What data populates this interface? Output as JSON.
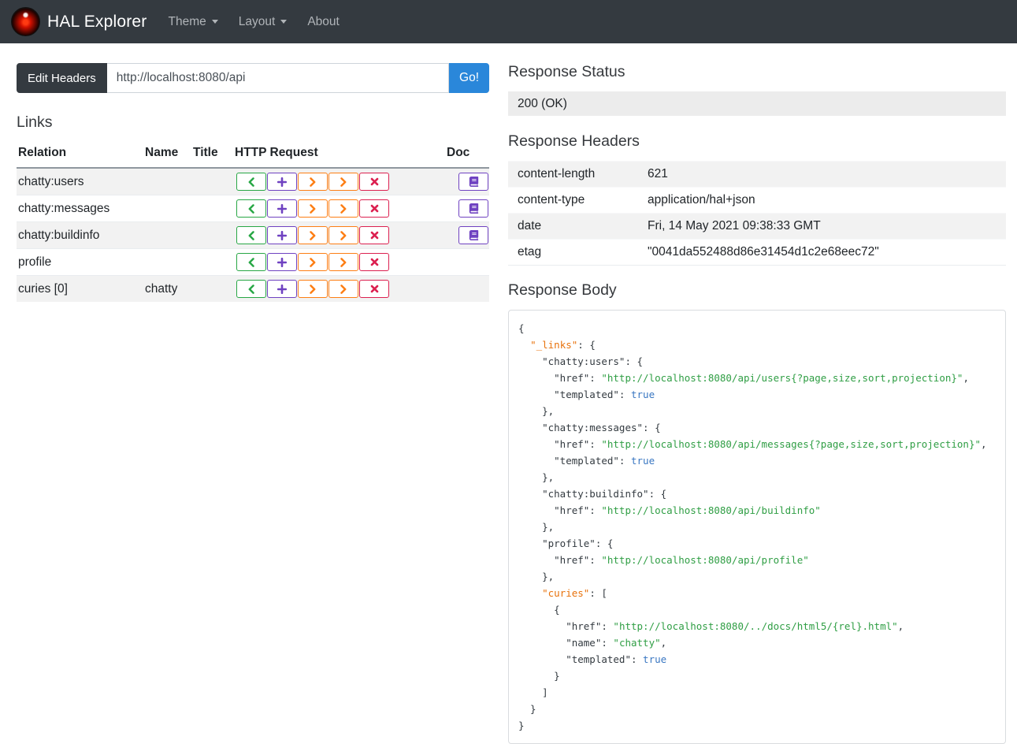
{
  "navbar": {
    "brand": "HAL Explorer",
    "logo": "hal-9000-eye-icon",
    "items": [
      {
        "label": "Theme",
        "has_caret": true
      },
      {
        "label": "Layout",
        "has_caret": true
      },
      {
        "label": "About",
        "has_caret": false
      }
    ]
  },
  "request_bar": {
    "edit_headers_label": "Edit Headers",
    "url_value": "http://localhost:8080/api",
    "go_label": "Go!"
  },
  "links_section": {
    "title": "Links",
    "columns": {
      "relation": "Relation",
      "name": "Name",
      "title": "Title",
      "http_request": "HTTP Request",
      "doc": "Doc"
    },
    "http_buttons": [
      {
        "method": "get",
        "icon": "chevron-left-icon",
        "color": "#28a745"
      },
      {
        "method": "post",
        "icon": "plus-icon",
        "color": "#6f42c1"
      },
      {
        "method": "put",
        "icon": "chevron-right-icon",
        "color": "#fd7e14"
      },
      {
        "method": "patch",
        "icon": "chevron-right-icon",
        "color": "#fd7e14"
      },
      {
        "method": "delete",
        "icon": "x-icon",
        "color": "#dc2050"
      }
    ],
    "doc_button": {
      "icon": "book-icon",
      "color": "#6f42c1"
    },
    "rows": [
      {
        "relation": "chatty:users",
        "name": "",
        "title": "",
        "doc": true
      },
      {
        "relation": "chatty:messages",
        "name": "",
        "title": "",
        "doc": true
      },
      {
        "relation": "chatty:buildinfo",
        "name": "",
        "title": "",
        "doc": true
      },
      {
        "relation": "profile",
        "name": "",
        "title": "",
        "doc": false
      },
      {
        "relation": "curies [0]",
        "name": "chatty",
        "title": "",
        "doc": false
      }
    ]
  },
  "response": {
    "status": {
      "title": "Response Status",
      "value": "200 (OK)"
    },
    "headers": {
      "title": "Response Headers",
      "rows": [
        {
          "name": "content-length",
          "value": "621"
        },
        {
          "name": "content-type",
          "value": "application/hal+json"
        },
        {
          "name": "date",
          "value": "Fri, 14 May 2021 09:38:33 GMT"
        },
        {
          "name": "etag",
          "value": "\"0041da552488d86e31454d1c2e68eec72\""
        }
      ]
    },
    "body": {
      "title": "Response Body",
      "syntax_colors": {
        "plain": "#333a40",
        "hal_key": "#e8720c",
        "string": "#2f9e44",
        "boolean": "#3a77c2"
      },
      "lines": [
        [
          [
            "p",
            "{"
          ]
        ],
        [
          [
            "p",
            "  "
          ],
          [
            "k",
            "\"_links\""
          ],
          [
            "p",
            ": {"
          ]
        ],
        [
          [
            "p",
            "    \"chatty:users\": {"
          ]
        ],
        [
          [
            "p",
            "      \"href\": "
          ],
          [
            "s",
            "\"http://localhost:8080/api/users{?page,size,sort,projection}\""
          ],
          [
            "p",
            ","
          ]
        ],
        [
          [
            "p",
            "      \"templated\": "
          ],
          [
            "b",
            "true"
          ]
        ],
        [
          [
            "p",
            "    },"
          ]
        ],
        [
          [
            "p",
            "    \"chatty:messages\": {"
          ]
        ],
        [
          [
            "p",
            "      \"href\": "
          ],
          [
            "s",
            "\"http://localhost:8080/api/messages{?page,size,sort,projection}\""
          ],
          [
            "p",
            ","
          ]
        ],
        [
          [
            "p",
            "      \"templated\": "
          ],
          [
            "b",
            "true"
          ]
        ],
        [
          [
            "p",
            "    },"
          ]
        ],
        [
          [
            "p",
            "    \"chatty:buildinfo\": {"
          ]
        ],
        [
          [
            "p",
            "      \"href\": "
          ],
          [
            "s",
            "\"http://localhost:8080/api/buildinfo\""
          ]
        ],
        [
          [
            "p",
            "    },"
          ]
        ],
        [
          [
            "p",
            "    \"profile\": {"
          ]
        ],
        [
          [
            "p",
            "      \"href\": "
          ],
          [
            "s",
            "\"http://localhost:8080/api/profile\""
          ]
        ],
        [
          [
            "p",
            "    },"
          ]
        ],
        [
          [
            "p",
            "    "
          ],
          [
            "k",
            "\"curies\""
          ],
          [
            "p",
            ": ["
          ]
        ],
        [
          [
            "p",
            "      {"
          ]
        ],
        [
          [
            "p",
            "        \"href\": "
          ],
          [
            "s",
            "\"http://localhost:8080/../docs/html5/{rel}.html\""
          ],
          [
            "p",
            ","
          ]
        ],
        [
          [
            "p",
            "        \"name\": "
          ],
          [
            "s",
            "\"chatty\""
          ],
          [
            "p",
            ","
          ]
        ],
        [
          [
            "p",
            "        \"templated\": "
          ],
          [
            "b",
            "true"
          ]
        ],
        [
          [
            "p",
            "      }"
          ]
        ],
        [
          [
            "p",
            "    ]"
          ]
        ],
        [
          [
            "p",
            "  }"
          ]
        ],
        [
          [
            "p",
            "}"
          ]
        ]
      ]
    }
  }
}
